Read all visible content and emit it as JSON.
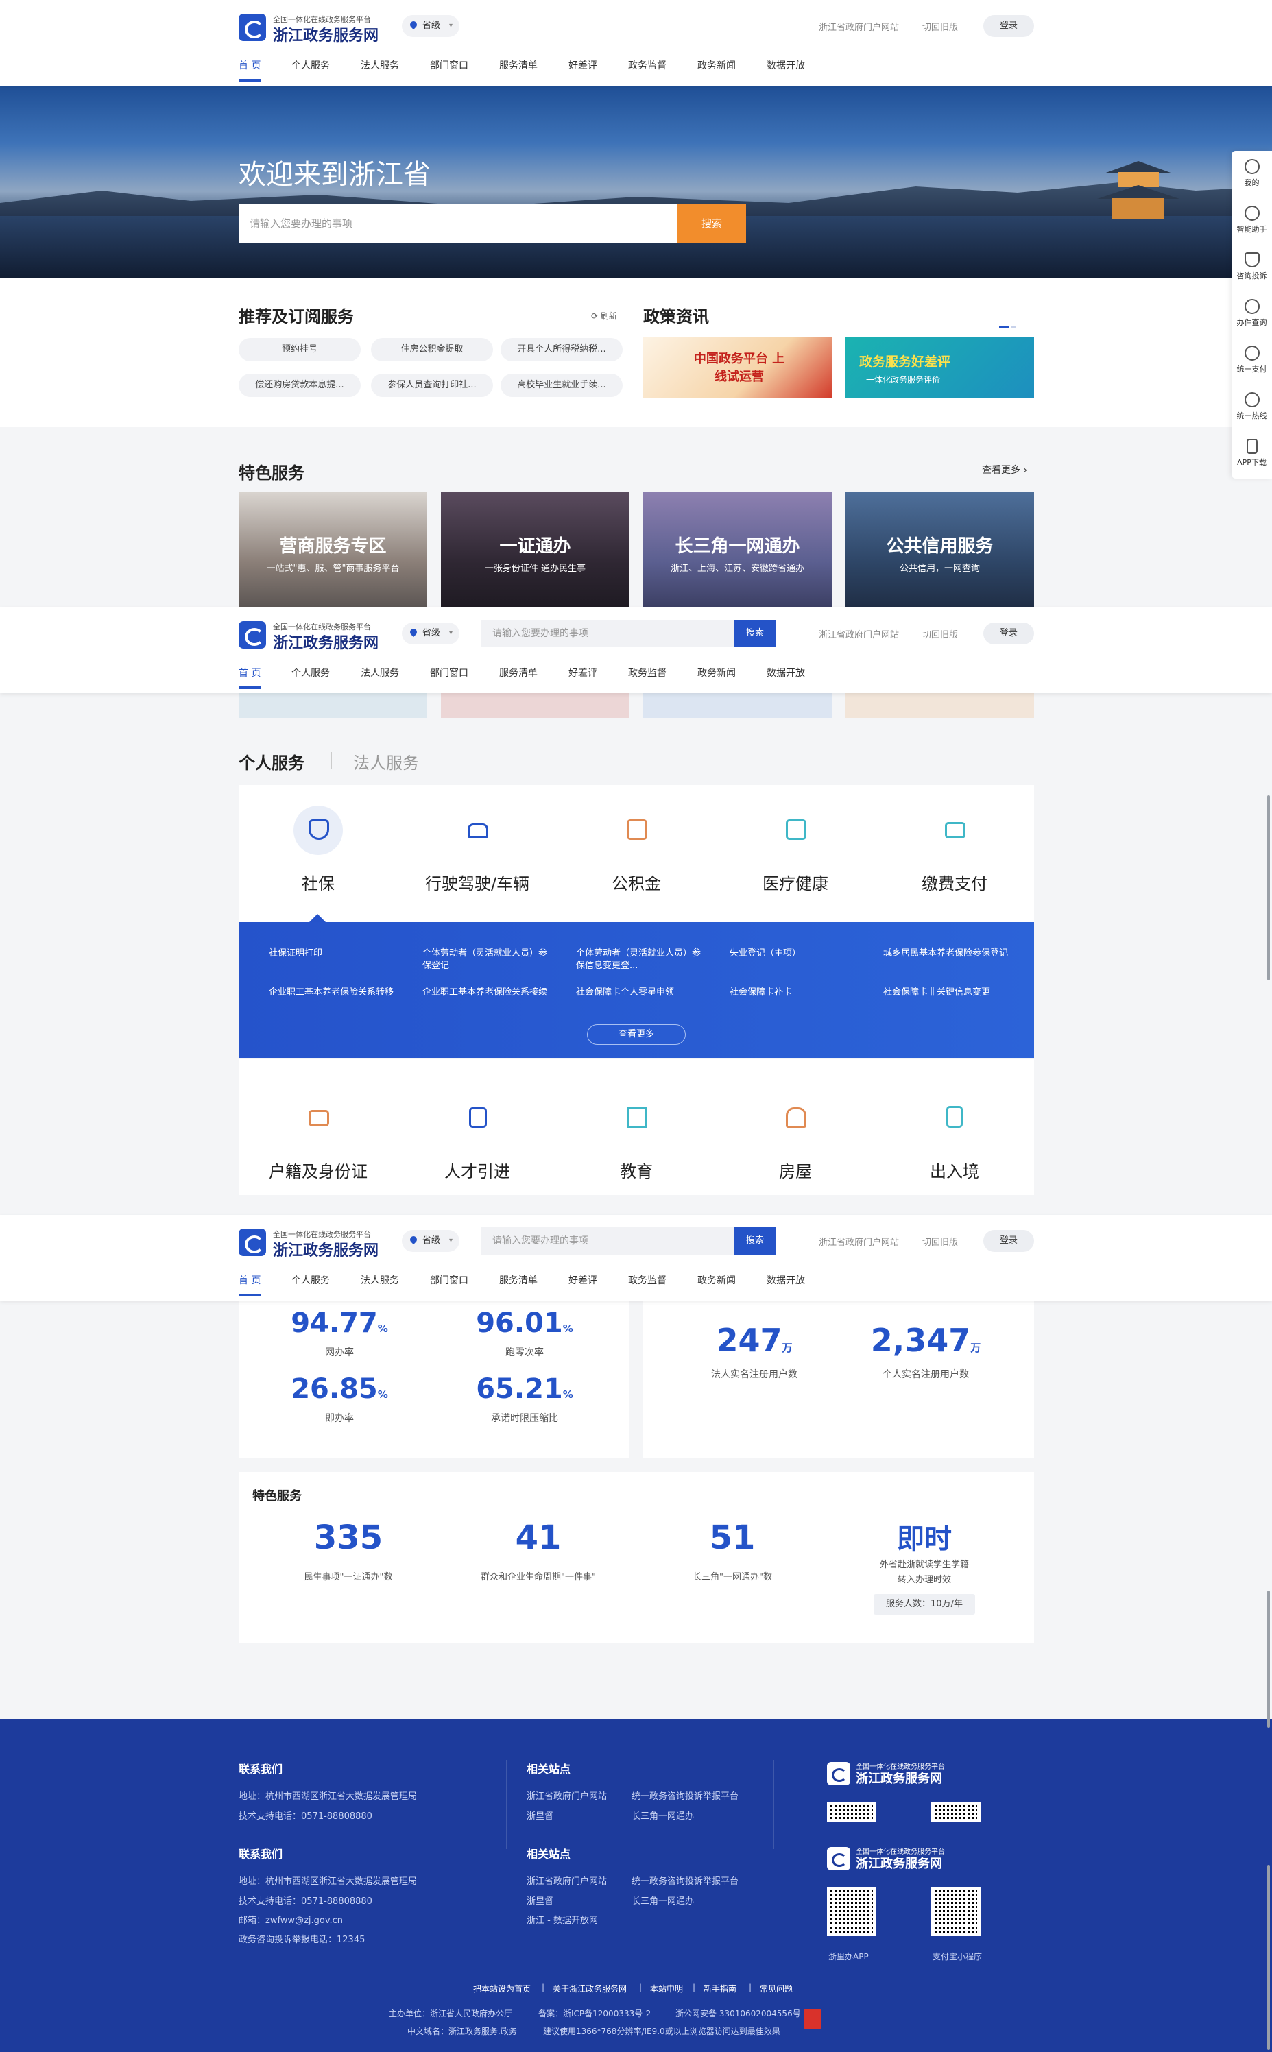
{
  "header": {
    "logo_sub": "全国一体化在线政务服务平台",
    "logo_main": "浙江政务服务网",
    "region": "省级",
    "search_placeholder": "请输入您要办理的事项",
    "search_button": "搜索",
    "link_portal": "浙江省政府门户网站",
    "link_old": "切回旧版",
    "login": "登录",
    "nav": [
      "首 页",
      "个人服务",
      "法人服务",
      "部门窗口",
      "服务清单",
      "好差评",
      "政务监督",
      "政务新闻",
      "数据开放"
    ]
  },
  "banner": {
    "welcome": "欢迎来到浙江省",
    "search_placeholder": "请输入您要办理的事项",
    "search_button": "搜索"
  },
  "recommend": {
    "title": "推荐及订阅服务",
    "refresh": "刷新",
    "items": [
      "预约挂号",
      "住房公积金提取",
      "开具个人所得税纳税...",
      "偿还购房贷款本息提...",
      "参保人员查询打印社...",
      "高校毕业生就业手续..."
    ]
  },
  "policy": {
    "title": "政策资讯",
    "banner1": "中国政务平台 上线试运营",
    "banner2_title": "政务服务好差评",
    "banner2_sub": "一体化政务服务评价"
  },
  "featured": {
    "title": "特色服务",
    "more": "查看更多",
    "cards": [
      {
        "title": "营商服务专区",
        "sub": "一站式\"惠、服、管\"商事服务平台"
      },
      {
        "title": "一证通办",
        "sub": "一张身份证件 通办民生事"
      },
      {
        "title": "长三角一网通办",
        "sub": "浙江、上海、江苏、安徽跨省通办"
      },
      {
        "title": "公共信用服务",
        "sub": "公共信用，一网查询"
      }
    ]
  },
  "services": {
    "tab_personal": "个人服务",
    "tab_legal": "法人服务",
    "row1": [
      "社保",
      "行驶驾驶/车辆",
      "公积金",
      "医疗健康",
      "缴费支付"
    ],
    "row2": [
      "户籍及身份证",
      "人才引进",
      "教育",
      "房屋",
      "出入境"
    ],
    "panel_items": [
      "社保证明打印",
      "个体劳动者（灵活就业人员）参保登记",
      "个体劳动者（灵活就业人员）参保信息变更登...",
      "失业登记（主项）",
      "城乡居民基本养老保险参保登记",
      "企业职工基本养老保险关系转移",
      "企业职工基本养老保险关系接续",
      "社会保障卡个人零星申领",
      "社会保障卡补卡",
      "社会保障卡非关键信息变更"
    ],
    "panel_more": "查看更多"
  },
  "stats": {
    "left": [
      {
        "num": "94.77",
        "unit": "%",
        "label": "网办率"
      },
      {
        "num": "96.01",
        "unit": "%",
        "label": "跑零次率"
      },
      {
        "num": "26.85",
        "unit": "%",
        "label": "即办率"
      },
      {
        "num": "65.21",
        "unit": "%",
        "label": "承诺时限压缩比"
      }
    ],
    "right": [
      {
        "num": "247",
        "unit": "万",
        "label": "法人实名注册用户数"
      },
      {
        "num": "2,347",
        "unit": "万",
        "label": "个人实名注册用户数"
      }
    ],
    "featured_title": "特色服务",
    "featured": [
      {
        "num": "335",
        "label": "民生事项\"一证通办\"数"
      },
      {
        "num": "41",
        "label": "群众和企业生命周期\"一件事\""
      },
      {
        "num": "51",
        "label": "长三角\"一网通办\"数"
      },
      {
        "num": "即时",
        "label": "外省赴浙就读学生学籍转入办理时效"
      }
    ],
    "served_tag": "服务人数：10万/年"
  },
  "footer": {
    "contact_title": "联系我们",
    "contact_addr": "地址：杭州市西湖区浙江省大数据发展管理局",
    "contact_tel": "技术支持电话：0571-88808880",
    "contact_email": "邮箱：zwfww@zj.gov.cn",
    "contact_hotline": "政务咨询投诉举报电话：12345",
    "sites_title": "相关站点",
    "site_portal": "浙江省政府门户网站",
    "site_complaint": "统一政务咨询投诉举报平台",
    "site_zlb": "浙里督",
    "site_yrd": "长三角一网通办",
    "site_data": "浙江 - 数据开放网",
    "logo_sub": "全国一体化在线政务服务平台",
    "logo_main": "浙江政务服务网",
    "qr_app": "浙里办APP",
    "qr_alipay": "支付宝小程序",
    "links": [
      "把本站设为首页",
      "关于浙江政务服务网",
      "本站申明",
      "新手指南",
      "常见问题"
    ],
    "sponsor": "主办单位：浙江省人民政府办公厅",
    "icp": "备案：浙ICP备12000333号-2",
    "police": "浙公网安备 33010602004556号",
    "domain": "中文域名：浙江政务服务.政务",
    "browser": "建议使用1366*768分辨率/IE9.0或以上浏览器访问达到最佳效果"
  },
  "sidebar": [
    "我的",
    "智能助手",
    "咨询投诉",
    "办件查询",
    "统一支付",
    "统一热线",
    "APP下载"
  ],
  "colors": {
    "primary": "#2453c8",
    "accent": "#f28d2c",
    "footer": "#1d3b9c"
  }
}
